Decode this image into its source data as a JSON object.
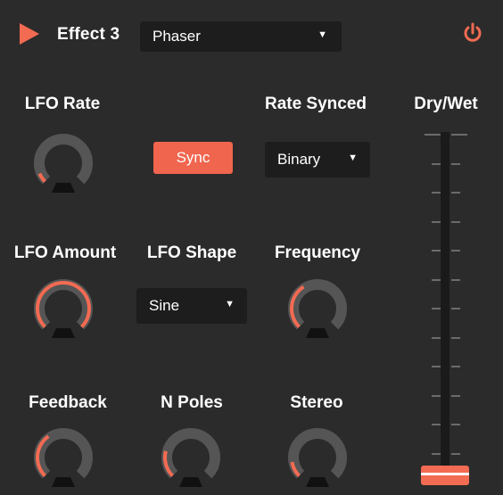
{
  "header": {
    "title": "Effect 3",
    "effect_type": "Phaser",
    "power_icon": "power-icon"
  },
  "colors": {
    "accent": "#f26b52",
    "panel": "#2b2b2b",
    "field": "#1d1d1d",
    "knob_track": "#555555"
  },
  "lfo_rate": {
    "label": "LFO Rate",
    "value": 0.08
  },
  "sync": {
    "label": "Sync"
  },
  "rate_synced": {
    "label": "Rate Synced",
    "value": "Binary"
  },
  "dry_wet": {
    "label": "Dry/Wet",
    "value": 0.0
  },
  "lfo_amount": {
    "label": "LFO Amount",
    "value": 1.0
  },
  "lfo_shape": {
    "label": "LFO Shape",
    "value": "Sine"
  },
  "frequency": {
    "label": "Frequency",
    "value": 0.38
  },
  "feedback": {
    "label": "Feedback",
    "value": 0.37
  },
  "n_poles": {
    "label": "N Poles",
    "value": 0.22
  },
  "stereo": {
    "label": "Stereo",
    "value": 0.13
  }
}
